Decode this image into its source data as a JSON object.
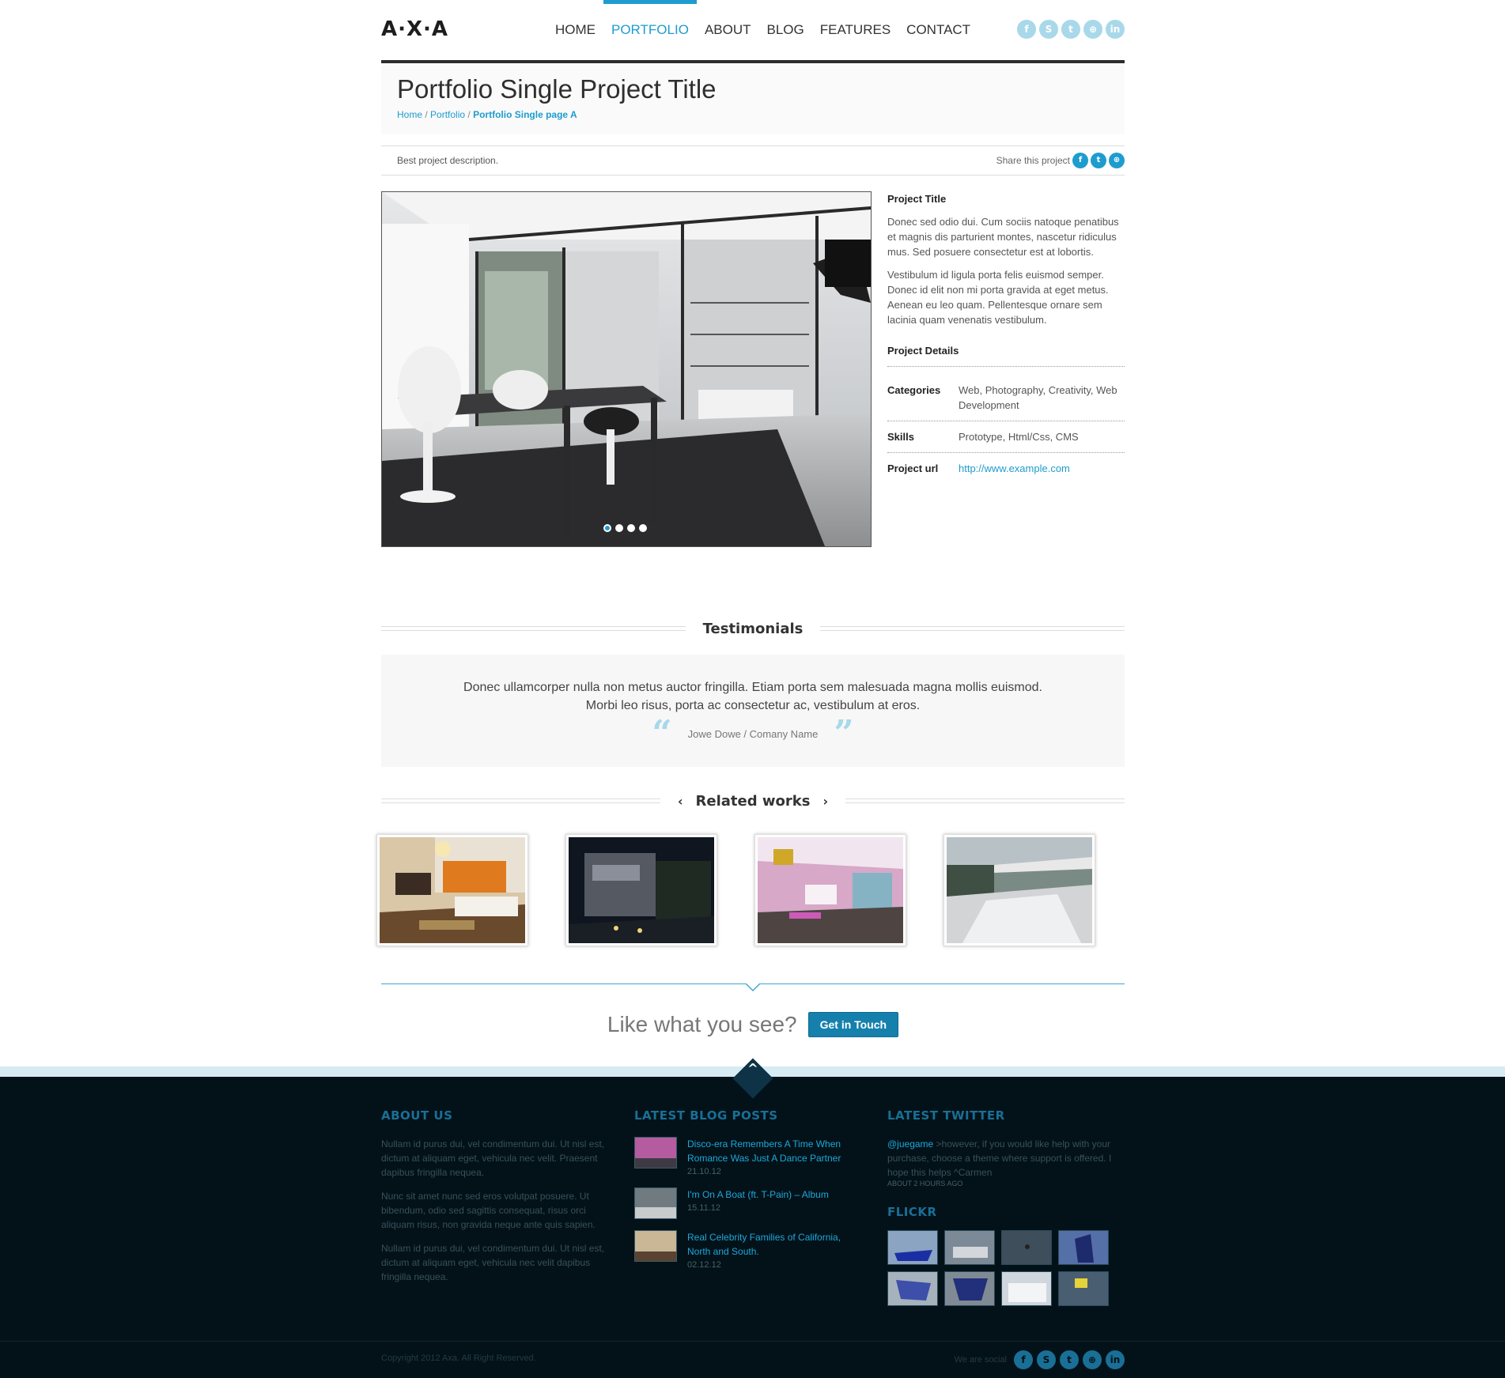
{
  "brand": {
    "logo": "A·X·A"
  },
  "nav": [
    {
      "label": "HOME",
      "active": false
    },
    {
      "label": "PORTFOLIO",
      "active": true
    },
    {
      "label": "ABOUT",
      "active": false
    },
    {
      "label": "BLOG",
      "active": false
    },
    {
      "label": "FEATURES",
      "active": false
    },
    {
      "label": "CONTACT",
      "active": false
    }
  ],
  "social_icons": [
    "facebook-icon",
    "skype-icon",
    "twitter-icon",
    "dribbble-icon",
    "linkedin-icon"
  ],
  "page": {
    "title": "Portfolio Single Project Title",
    "breadcrumb": {
      "home": "Home",
      "sep": " / ",
      "section": "Portfolio",
      "current": "Portfolio Single page A"
    },
    "description": "Best project description.",
    "share_label": "Share this project"
  },
  "gallery": {
    "slides": 4,
    "active_slide": 1
  },
  "project": {
    "title": "Project Title",
    "para1": "Donec sed odio dui. Cum sociis natoque penatibus et magnis dis parturient montes, nascetur ridiculus mus. Sed posuere consectetur est at lobortis.",
    "para2": "Vestibulum id ligula porta felis euismod semper. Donec id elit non mi porta gravida at eget metus. Aenean eu leo quam. Pellentesque ornare sem lacinia quam venenatis vestibulum.",
    "details_title": "Project Details",
    "details": [
      {
        "label": "Categories",
        "value": "Web, Photography, Creativity, Web Development"
      },
      {
        "label": "Skills",
        "value": "Prototype, Html/Css, CMS"
      },
      {
        "label": "Project url",
        "value": "http://www.example.com"
      }
    ]
  },
  "testimonials": {
    "heading": "Testimonials",
    "quote_line1": "Donec ullamcorper nulla non metus auctor fringilla. Etiam porta sem malesuada magna mollis euismod.",
    "quote_line2": "Morbi leo risus, porta ac consectetur ac, vestibulum at eros.",
    "author": "Jowe Dowe / Comany Name",
    "open_quote": "“",
    "close_quote": "”"
  },
  "related": {
    "heading": "Related works",
    "prev_icon": "‹",
    "next_icon": "›"
  },
  "cta": {
    "text": "Like what you see?",
    "button": "Get in Touch"
  },
  "footer": {
    "about": {
      "heading": "ABOUT US",
      "p1": "Nullam id purus dui, vel condimentum dui. Ut nisl est, dictum at aliquam eget, vehicula nec velit. Praesent dapibus fringilla nequea.",
      "p2": "Nunc sit amet nunc sed eros volutpat posuere. Ut bibendum, odio sed sagittis consequat, risus orci aliquam risus, non gravida neque ante quis sapien.",
      "p3": "Nullam id purus dui, vel condimentum dui. Ut nisl est, dictum at aliquam eget, vehicula nec velit dapibus fringilla nequea."
    },
    "blog": {
      "heading": "LATEST BLOG POSTS",
      "posts": [
        {
          "title": "Disco-era Remembers A Time When Romance Was Just A Dance Partner",
          "date": "21.10.12"
        },
        {
          "title": "I'm On A Boat (ft. T-Pain) – Album",
          "date": "15.11.12"
        },
        {
          "title": "Real Celebrity Families of California, North and South.",
          "date": "02.12.12"
        }
      ]
    },
    "twitter": {
      "heading": "LATEST TWITTER",
      "handle": "@juegame",
      "text": " >however, if you would like help with your purchase, choose a theme where support is offered. I hope this helps ^Carmen",
      "time": "ABOUT 2 HOURS AGO"
    },
    "flickr": {
      "heading": "FLICKR",
      "count": 8
    },
    "copyright": "Copyright 2012 Axa. All Right Reserved.",
    "social_label": "We are social",
    "to_top_icon": "^"
  }
}
